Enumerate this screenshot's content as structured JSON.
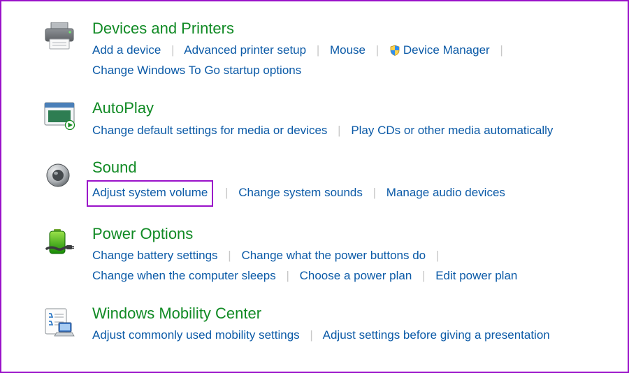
{
  "sections": [
    {
      "title": "Devices and Printers",
      "icon": "printer-icon",
      "links": [
        "Add a device",
        "Advanced printer setup",
        "Mouse",
        "Device Manager",
        "Change Windows To Go startup options"
      ]
    },
    {
      "title": "AutoPlay",
      "icon": "autoplay-icon",
      "links": [
        "Change default settings for media or devices",
        "Play CDs or other media automatically"
      ]
    },
    {
      "title": "Sound",
      "icon": "speaker-icon",
      "links": [
        "Adjust system volume",
        "Change system sounds",
        "Manage audio devices"
      ],
      "highlighted_link_index": 0
    },
    {
      "title": "Power Options",
      "icon": "battery-icon",
      "links": [
        "Change battery settings",
        "Change what the power buttons do",
        "Change when the computer sleeps",
        "Choose a power plan",
        "Edit power plan"
      ]
    },
    {
      "title": "Windows Mobility Center",
      "icon": "mobility-icon",
      "links": [
        "Adjust commonly used mobility settings",
        "Adjust settings before giving a presentation"
      ]
    }
  ],
  "colors": {
    "heading": "#108a24",
    "link": "#0b5aa7",
    "highlight_border": "#9a12c9"
  }
}
